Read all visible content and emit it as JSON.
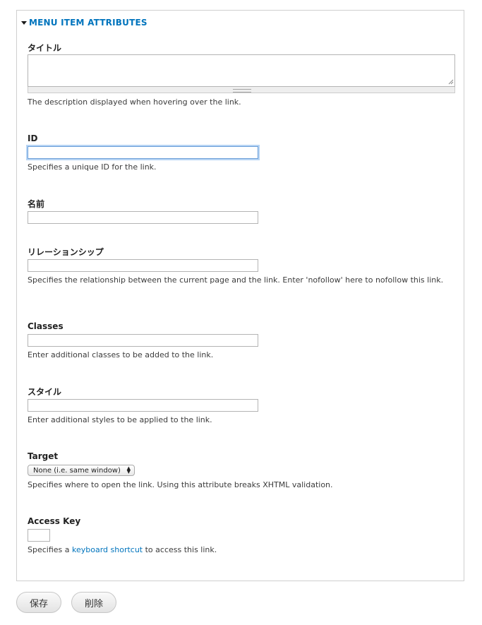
{
  "section": {
    "legend": "MENU ITEM ATTRIBUTES"
  },
  "fields": {
    "title": {
      "label": "タイトル",
      "value": "",
      "description": "The description displayed when hovering over the link."
    },
    "id": {
      "label": "ID",
      "value": "",
      "description": "Specifies a unique ID for the link."
    },
    "name": {
      "label": "名前",
      "value": ""
    },
    "relationship": {
      "label": "リレーションシップ",
      "value": "",
      "description": "Specifies the relationship between the current page and the link. Enter 'nofollow' here to nofollow this link."
    },
    "classes": {
      "label": "Classes",
      "value": "",
      "description": "Enter additional classes to be added to the link."
    },
    "style": {
      "label": "スタイル",
      "value": "",
      "description": "Enter additional styles to be applied to the link."
    },
    "target": {
      "label": "Target",
      "selected": "None (i.e. same window)",
      "description": "Specifies where to open the link. Using this attribute breaks XHTML validation."
    },
    "access_key": {
      "label": "Access Key",
      "value": "",
      "description_prefix": "Specifies a ",
      "description_link": "keyboard shortcut",
      "description_suffix": " to access this link."
    }
  },
  "actions": {
    "save": "保存",
    "delete": "削除"
  },
  "colors": {
    "link": "#0074bd",
    "focus_ring": "#b8d5f4"
  }
}
